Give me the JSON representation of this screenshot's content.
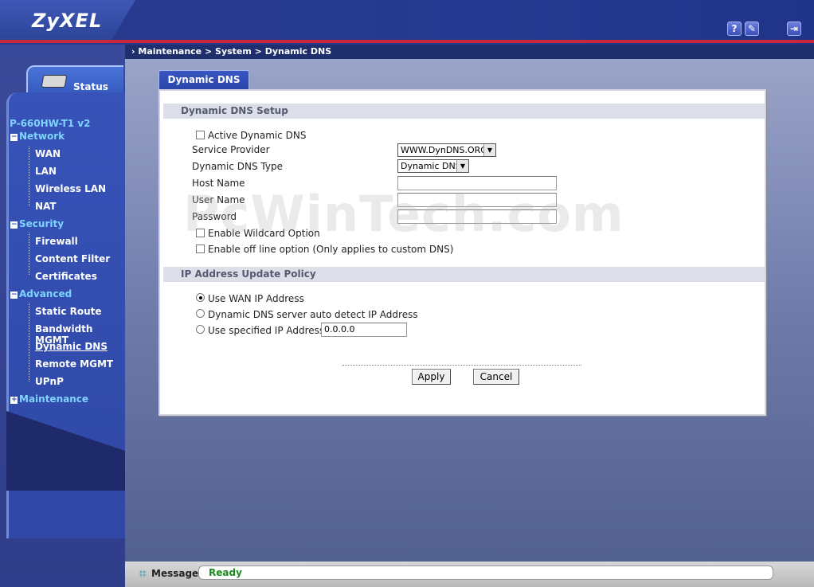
{
  "header": {
    "logo": "ZyXEL",
    "help_icon": "?",
    "wizard_icon": "wizard-icon",
    "logout_icon": "logout-icon"
  },
  "breadcrumb": "Maintenance > System > Dynamic DNS",
  "sidebar": {
    "status_label": "Status",
    "model": "P-660HW-T1 v2",
    "sections": [
      {
        "label": "Network",
        "items": [
          "WAN",
          "LAN",
          "Wireless LAN",
          "NAT"
        ]
      },
      {
        "label": "Security",
        "items": [
          "Firewall",
          "Content Filter",
          "Certificates"
        ]
      },
      {
        "label": "Advanced",
        "items": [
          "Static Route",
          "Bandwidth MGMT",
          "Dynamic DNS",
          "Remote MGMT",
          "UPnP"
        ]
      },
      {
        "label": "Maintenance",
        "items": []
      }
    ],
    "active_item": "Dynamic DNS"
  },
  "tab": {
    "label": "Dynamic DNS"
  },
  "setup": {
    "title": "Dynamic DNS Setup",
    "active_ddns_label": "Active Dynamic DNS",
    "active_ddns_checked": false,
    "service_provider_label": "Service Provider",
    "service_provider_value": "WWW.DynDNS.ORG",
    "ddns_type_label": "Dynamic DNS Type",
    "ddns_type_value": "Dynamic DNS",
    "host_name_label": "Host Name",
    "host_name_value": "",
    "user_name_label": "User Name",
    "user_name_value": "",
    "password_label": "Password",
    "password_value": "",
    "wildcard_label": "Enable Wildcard Option",
    "wildcard_checked": false,
    "offline_label": "Enable off line option (Only applies to custom DNS)",
    "offline_checked": false
  },
  "policy": {
    "title": "IP Address Update Policy",
    "options": [
      "Use WAN IP Address",
      "Dynamic DNS server auto detect IP Address",
      "Use specified IP Address"
    ],
    "selected": "Use WAN IP Address",
    "specified_ip": "0.0.0.0"
  },
  "buttons": {
    "apply": "Apply",
    "cancel": "Cancel"
  },
  "watermark": "PcWinTech.com",
  "status": {
    "label": "Message",
    "text": "Ready"
  }
}
